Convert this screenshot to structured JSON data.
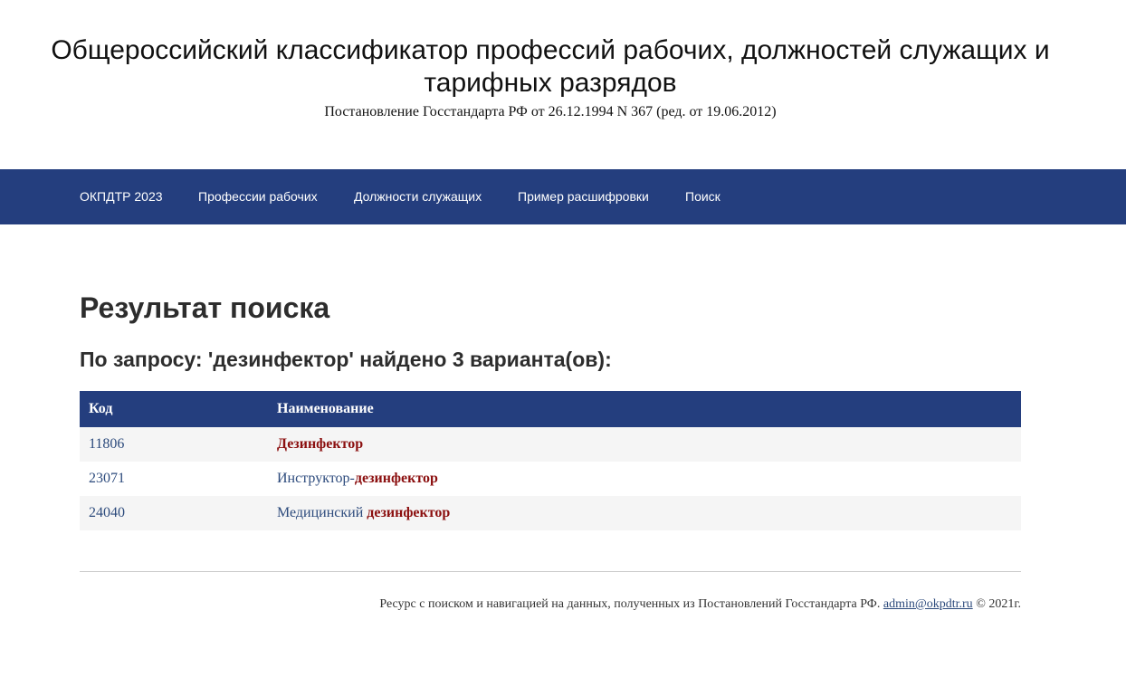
{
  "header": {
    "title": "Общероссийский классификатор профессий рабочих, должностей служащих и тарифных разрядов",
    "subtitle": "Постановление Госстандарта РФ от 26.12.1994 N 367 (ред. от 19.06.2012)"
  },
  "nav": {
    "items": [
      {
        "label": "ОКПДТР 2023"
      },
      {
        "label": "Профессии рабочих"
      },
      {
        "label": "Должности служащих"
      },
      {
        "label": "Пример расшифровки"
      },
      {
        "label": "Поиск"
      }
    ]
  },
  "main": {
    "heading": "Результат поиска",
    "summary": "По запросу: 'дезинфектор' найдено 3 варианта(ов):",
    "table": {
      "columns": [
        "Код",
        "Наименование"
      ],
      "rows": [
        {
          "code": "11806",
          "name_prefix": "",
          "name_match": "Дезинфектор"
        },
        {
          "code": "23071",
          "name_prefix": "Инструктор-",
          "name_match": "дезинфектор"
        },
        {
          "code": "24040",
          "name_prefix": "Медицинский ",
          "name_match": "дезинфектор"
        }
      ]
    }
  },
  "footer": {
    "text": "Ресурс с поиском и навигацией на данных, полученных из Постановлений Госстандарта РФ.",
    "email": "admin@okpdtr.ru",
    "copyright": "© 2021г."
  },
  "colors": {
    "nav_background": "#243e7e",
    "highlight": "#8b0f0f",
    "link": "#2c4a7c"
  }
}
